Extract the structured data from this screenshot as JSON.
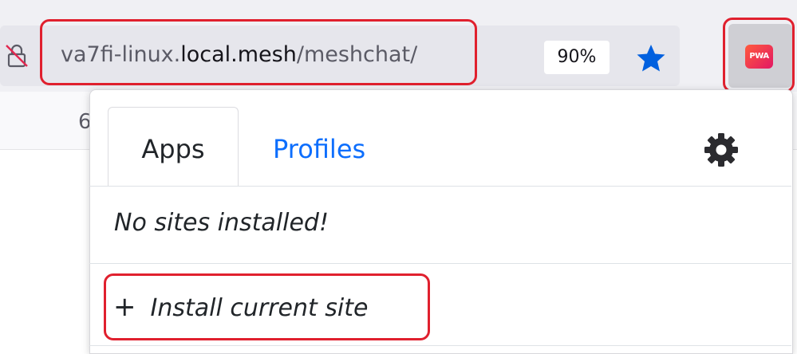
{
  "browser": {
    "url": {
      "prefix": "va7fi-linux.",
      "host": "local.mesh",
      "path": "/meshchat/"
    },
    "zoom_level": "90%",
    "lock_icon": "insecure-lock-icon",
    "star_icon": "bookmark-star-icon",
    "bookmark_star_color": "#0060df",
    "extension_button": {
      "logo_text": "PWA",
      "icon": "pwa-extension-icon"
    },
    "bookmarks_bar_fragment": "6"
  },
  "popup": {
    "tabs": [
      {
        "label": "Apps",
        "active": true
      },
      {
        "label": "Profiles",
        "active": false
      }
    ],
    "settings_icon": "gear-icon",
    "empty_message": "No sites installed!",
    "install_action": {
      "icon": "+",
      "label": "Install current site"
    }
  },
  "colors": {
    "highlight": "#e0202e",
    "link": "#0d6efd"
  }
}
